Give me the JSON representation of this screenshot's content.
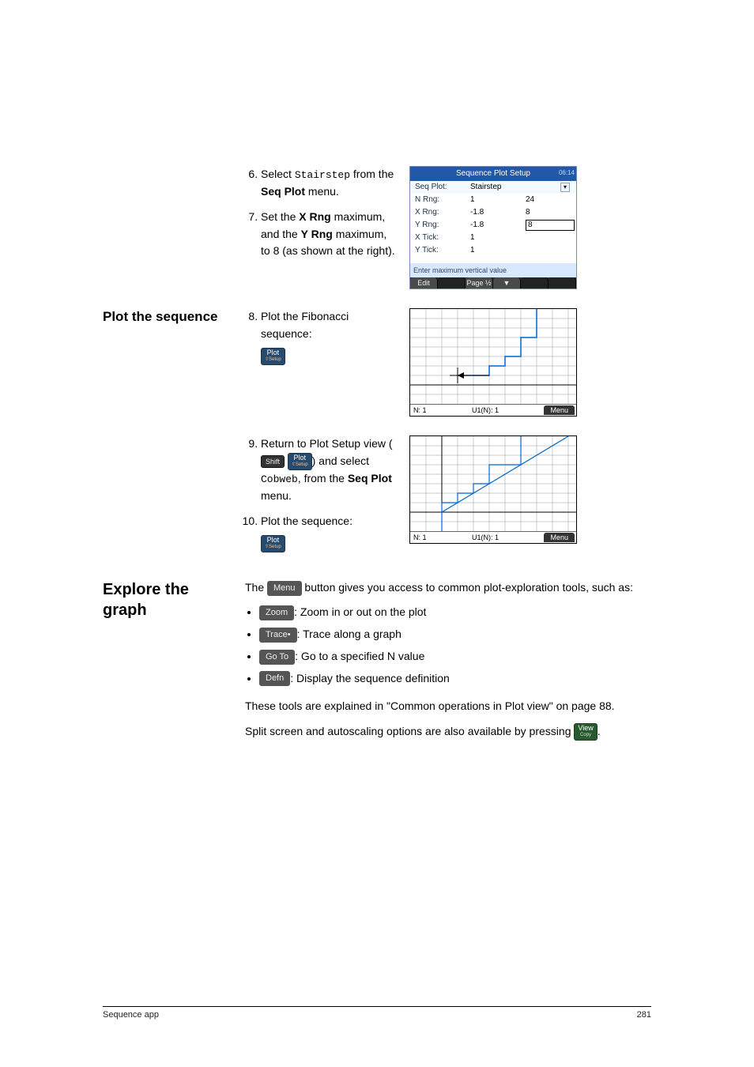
{
  "setup": {
    "title": "Sequence Plot Setup",
    "clock": "06:14",
    "seqplot_label": "Seq Plot:",
    "seqplot_value": "Stairstep",
    "nrng_label": "N Rng:",
    "nrng_v1": "1",
    "nrng_v2": "24",
    "xrng_label": "X Rng:",
    "xrng_v1": "-1.8",
    "xrng_v2": "8",
    "yrng_label": "Y Rng:",
    "yrng_v1": "-1.8",
    "yrng_v2": "8",
    "xtick_label": "X Tick:",
    "xtick_v": "1",
    "ytick_label": "Y Tick:",
    "ytick_v": "1",
    "prompt": "Enter maximum vertical value",
    "soft_edit": "Edit",
    "soft_page": "Page ½",
    "soft_arrow": "▼"
  },
  "step6": {
    "lead": "Select ",
    "code": "Stairstep",
    "mid": " from the ",
    "bold": "Seq Plot",
    "tail": " menu."
  },
  "step7": {
    "lead": "Set the ",
    "b1": "X Rng",
    "mid1": " maximum, and the ",
    "b2": "Y Rng",
    "tail": " maximum, to 8 (as shown at the right)."
  },
  "sideA": "Plot the sequence",
  "step8": "Plot the Fibonacci sequence:",
  "step9": {
    "lead": "Return to Plot Setup view (",
    "mid": ") and select ",
    "code": "Cobweb",
    "mid2": ", from the ",
    "bold": "Seq Plot",
    "tail": " menu."
  },
  "step10": "Plot the sequence:",
  "sideB": "Explore the graph",
  "explore_p": " button gives you access to common plot-exploration tools, such as:",
  "explore_lead": "The ",
  "menu_label": "Menu",
  "tools": {
    "zoom": {
      "btn": "Zoom",
      "desc": ": Zoom in or out on the plot"
    },
    "trace": {
      "btn": "Trace•",
      "desc": ": Trace along a graph"
    },
    "goto": {
      "btn": "Go To",
      "desc": ": Go to a specified N value"
    },
    "defn": {
      "btn": "Defn",
      "desc": ": Display the sequence definition"
    }
  },
  "para1": "These tools are explained in \"Common operations in Plot view\" on page 88.",
  "para2a": "Split screen and autoscaling options are also available by pressing ",
  "para2b": ".",
  "plot1": {
    "n": "N: 1",
    "u": "U1(N): 1",
    "menu": "Menu"
  },
  "plot2": {
    "n": "N: 1",
    "u": "U1(N): 1",
    "menu": "Menu"
  },
  "keys": {
    "plot_top": "Plot",
    "plot_sub": "⇧Setup",
    "shift": "Shift",
    "view_top": "View",
    "view_sub": "Copy"
  },
  "footer": {
    "app": "Sequence app",
    "page": "281"
  },
  "chart_data": [
    {
      "type": "line",
      "title": "Stairstep plot of Fibonacci U1(N)",
      "style": "stairstep",
      "x": [
        1,
        2,
        3,
        4,
        5,
        6
      ],
      "y": [
        1,
        1,
        2,
        3,
        5,
        8
      ],
      "xlim": [
        -1.8,
        8
      ],
      "ylim": [
        -1.8,
        8
      ],
      "xlabel": "N",
      "ylabel": "U1(N)"
    },
    {
      "type": "line",
      "title": "Cobweb plot of U1",
      "style": "cobweb",
      "points": [
        [
          1,
          1
        ],
        [
          1,
          1
        ],
        [
          1,
          2
        ],
        [
          2,
          2
        ],
        [
          2,
          3
        ],
        [
          3,
          3
        ],
        [
          3,
          5
        ],
        [
          5,
          5
        ],
        [
          5,
          8
        ],
        [
          8,
          8
        ]
      ],
      "xlim": [
        -1.8,
        8
      ],
      "ylim": [
        -1.8,
        8
      ]
    }
  ]
}
